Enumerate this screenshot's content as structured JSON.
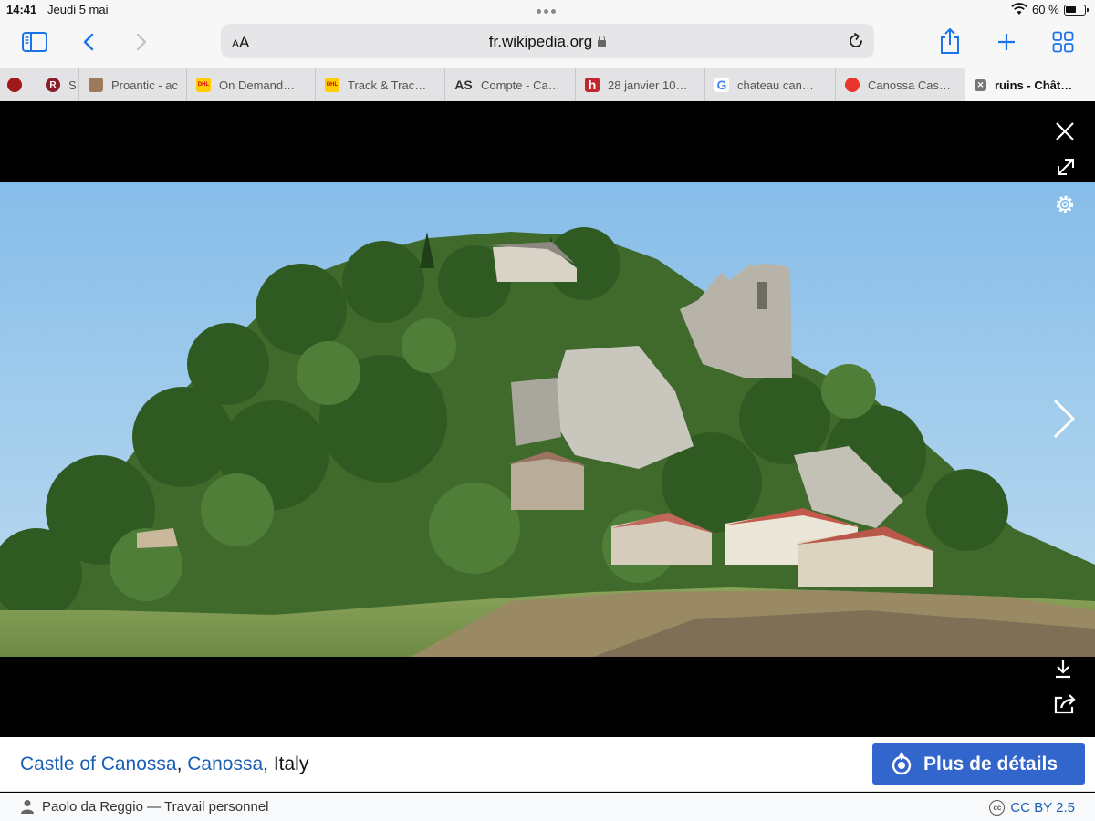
{
  "status": {
    "time": "14:41",
    "date": "Jeudi 5 mai",
    "battery": "60 %",
    "battery_level": 0.6
  },
  "toolbar": {
    "text_size_small": "A",
    "text_size_large": "A",
    "url": "fr.wikipedia.org"
  },
  "tabs": [
    {
      "label": "",
      "favicon_color": "#a01818",
      "favicon_text": ""
    },
    {
      "label": "S",
      "favicon_color": "#8b1c2b",
      "favicon_text": "R"
    },
    {
      "label": "Proantic - ac",
      "favicon_color": "#9b7b5c",
      "favicon_text": ""
    },
    {
      "label": "On Demand…",
      "favicon_color": "#ffcc00",
      "favicon_text": "DHL"
    },
    {
      "label": "Track & Trac…",
      "favicon_color": "#ffcc00",
      "favicon_text": "DHL"
    },
    {
      "label": "Compte - Ca…",
      "favicon_color": "#e3e3e5",
      "favicon_text": "AS"
    },
    {
      "label": "28 janvier 10…",
      "favicon_color": "#c1272d",
      "favicon_text": "h"
    },
    {
      "label": "chateau can…",
      "favicon_color": "#ffffff",
      "favicon_text": "G"
    },
    {
      "label": "Canossa Cas…",
      "favicon_color": "#e8342c",
      "favicon_text": ""
    },
    {
      "label": "ruins - Chât…",
      "favicon_color": "#777777",
      "favicon_text": "✕"
    }
  ],
  "caption": {
    "place": "Castle of Canossa",
    "sep1": ", ",
    "town": "Canossa",
    "sep2": ", ",
    "country": "Italy",
    "details_button": "Plus de détails"
  },
  "footer": {
    "author": "Paolo da Reggio",
    "dash": " — ",
    "work": "Travail personnel",
    "license": "CC BY 2.5",
    "cc_badge": "cc"
  },
  "colors": {
    "accent": "#1a73e8",
    "link": "#1a5fb4",
    "button": "#3366cc"
  },
  "icons": {
    "sidebar": "sidebar-icon",
    "back": "chevron-left-icon",
    "forward": "chevron-right-icon",
    "share": "share-icon",
    "new_tab": "plus-icon",
    "tabs_overview": "grid-icon",
    "close": "close-icon",
    "expand": "expand-icon",
    "settings": "gear-icon",
    "next": "chevron-right-icon",
    "download": "download-icon",
    "share_image": "share-out-icon"
  }
}
